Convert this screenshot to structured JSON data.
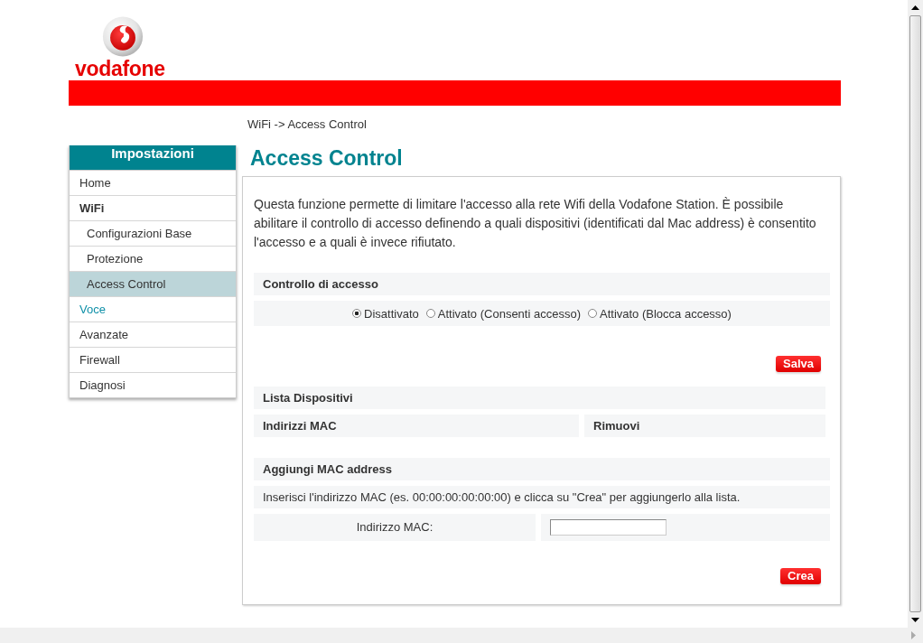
{
  "header": {
    "logo_text": "vodafone"
  },
  "breadcrumb": "WiFi -> Access Control",
  "sidebar": {
    "title": "Impostazioni",
    "items": [
      {
        "label": "Home",
        "kind": "item",
        "selected": false,
        "hovered": false
      },
      {
        "label": "WiFi",
        "kind": "section",
        "selected": false,
        "hovered": false
      },
      {
        "label": "Configurazioni Base",
        "kind": "sub",
        "selected": false,
        "hovered": false
      },
      {
        "label": "Protezione",
        "kind": "sub",
        "selected": false,
        "hovered": false
      },
      {
        "label": "Access Control",
        "kind": "sub",
        "selected": true,
        "hovered": false
      },
      {
        "label": "Voce",
        "kind": "item",
        "selected": false,
        "hovered": true
      },
      {
        "label": "Avanzate",
        "kind": "item",
        "selected": false,
        "hovered": false
      },
      {
        "label": "Firewall",
        "kind": "item",
        "selected": false,
        "hovered": false
      },
      {
        "label": "Diagnosi",
        "kind": "item",
        "selected": false,
        "hovered": false
      }
    ]
  },
  "page_title": "Access Control",
  "description": "Questa funzione permette di limitare l'accesso alla rete Wifi della Vodafone Station. È possibile abilitare il controllo di accesso definendo a quali dispositivi (identificati dal Mac address) è consentito l'accesso e a quali è invece rifiutato.",
  "access_control": {
    "title": "Controllo di accesso",
    "options": [
      {
        "label": "Disattivato",
        "selected": true
      },
      {
        "label": "Attivato (Consenti accesso)",
        "selected": false
      },
      {
        "label": "Attivato (Blocca accesso)",
        "selected": false
      }
    ],
    "button": "Salva"
  },
  "device_list": {
    "title": "Lista Dispositivi",
    "columns": [
      "Indirizzi MAC",
      "Rimuovi"
    ]
  },
  "add_mac": {
    "title": "Aggiungi MAC address",
    "hint": "Inserisci l'indirizzo MAC (es. 00:00:00:00:00:00) e clicca su \"Crea\" per aggiungerlo alla lista.",
    "field_label": "Indirizzo MAC:",
    "button": "Crea"
  }
}
